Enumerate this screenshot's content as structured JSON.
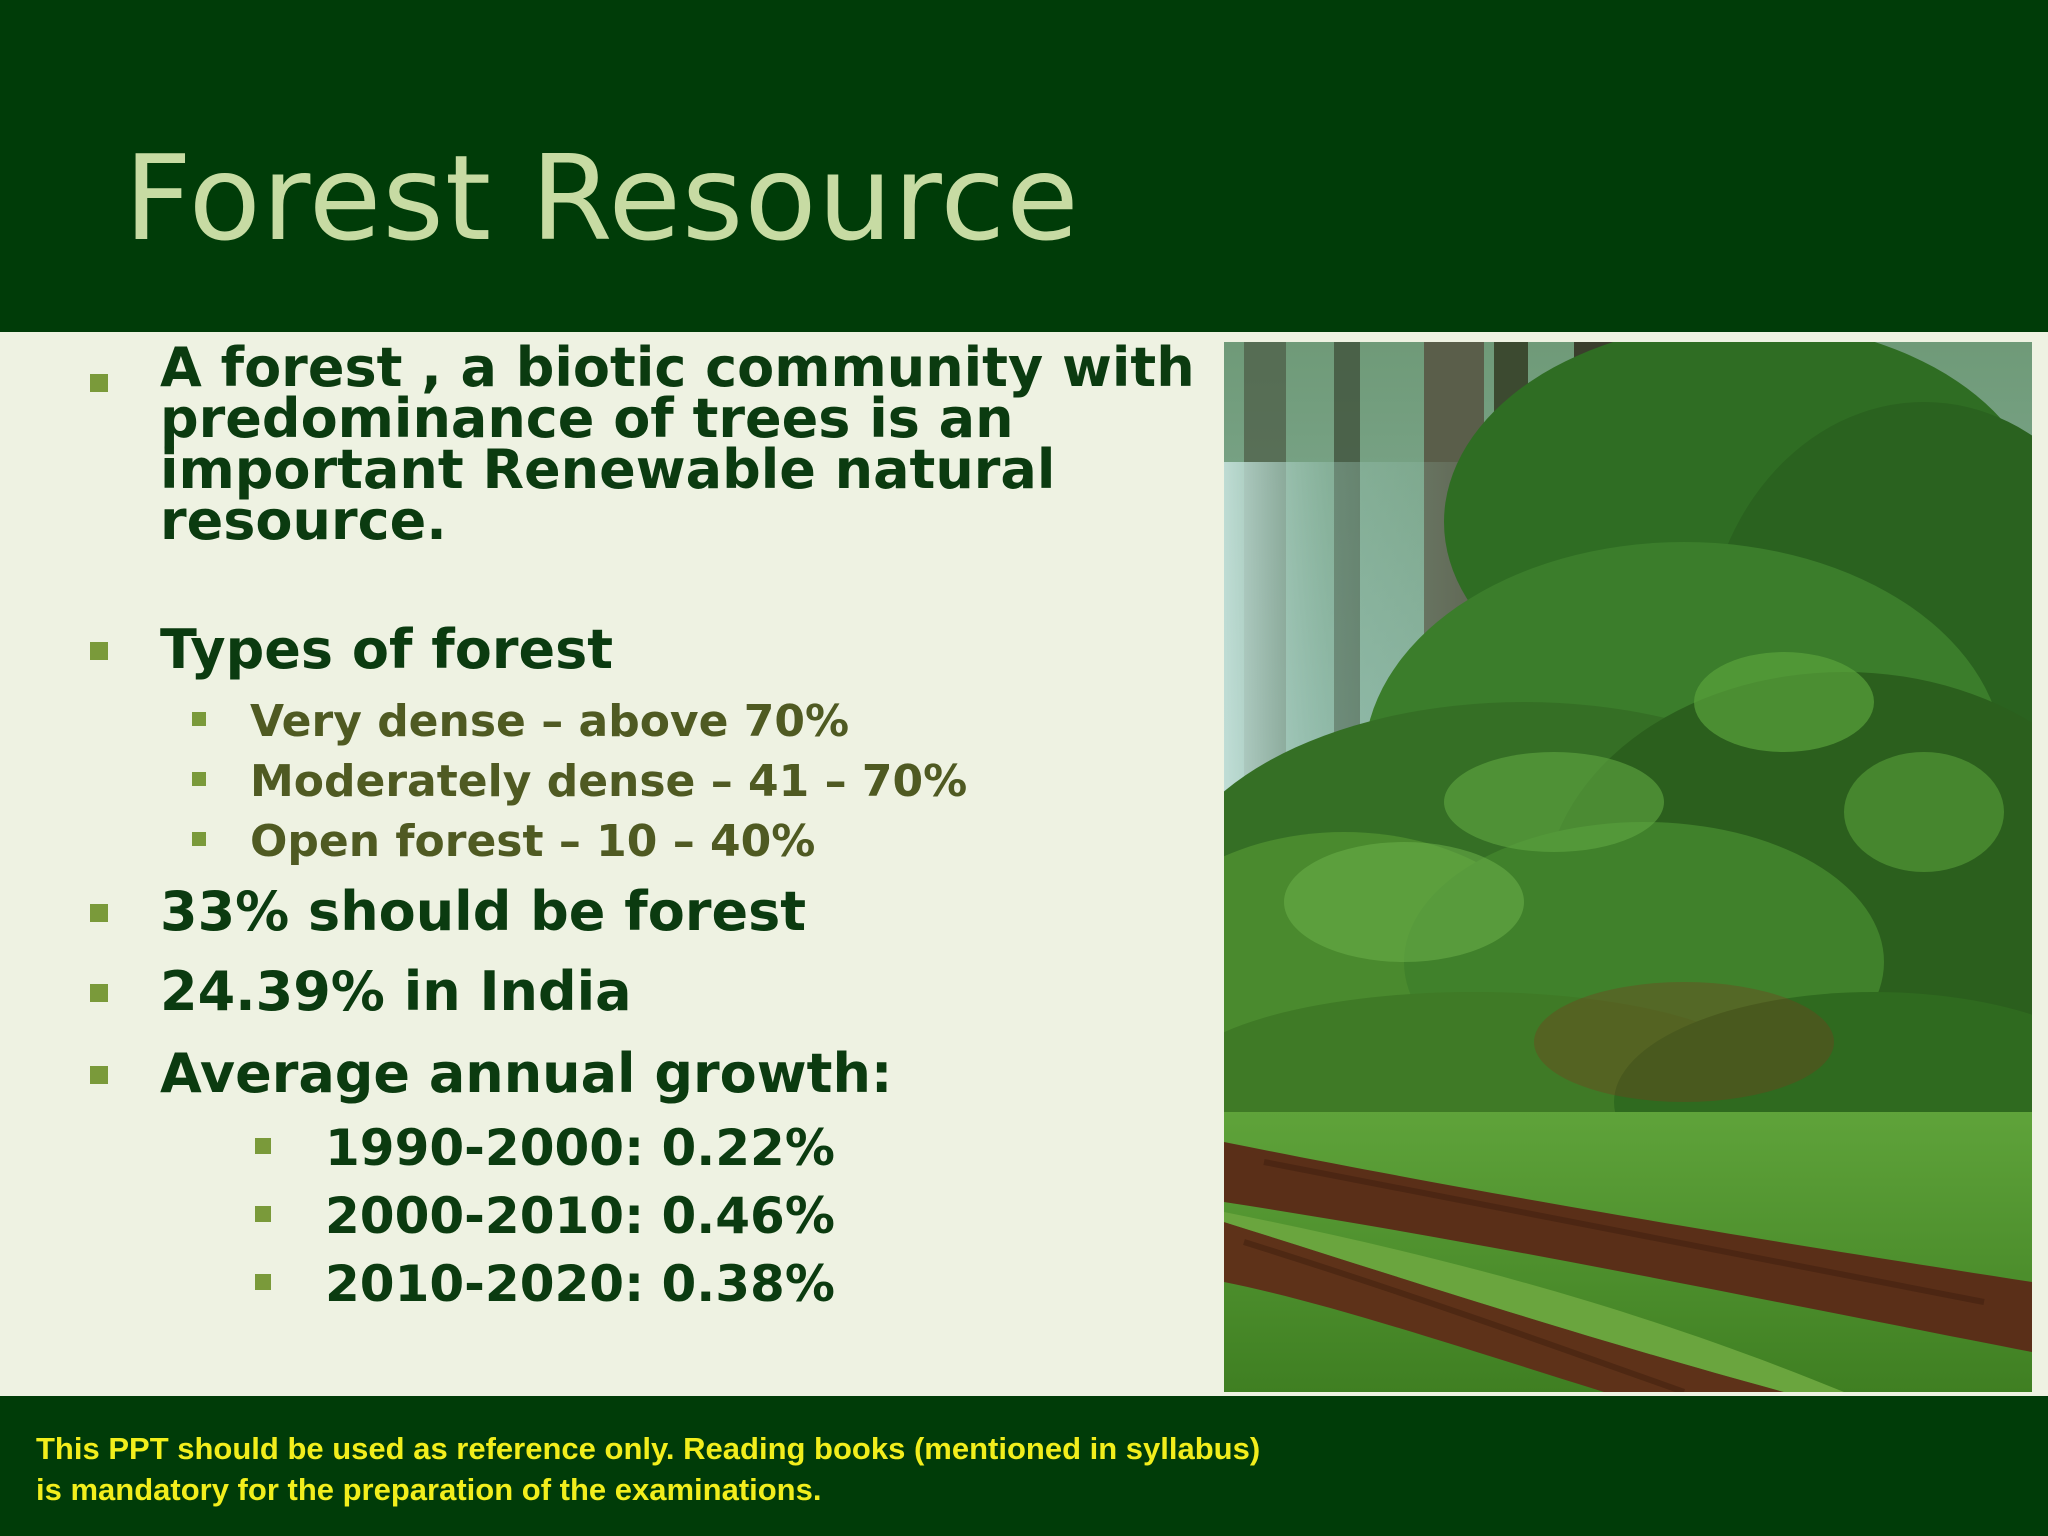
{
  "slide": {
    "title": "Forest Resource"
  },
  "bullets": [
    {
      "lines": [
        "A forest , a biotic community with",
        "predominance of trees is an",
        "important Renewable natural",
        "resource."
      ]
    },
    {
      "text": "Types of forest",
      "sub": [
        "Very dense – above 70%",
        "Moderately dense – 41 – 70%",
        "Open forest – 10 – 40%"
      ]
    },
    {
      "text": "33% should be forest"
    },
    {
      "text": "24.39% in India"
    },
    {
      "text": "Average annual growth:",
      "sub": [
        "1990-2000: 0.22%",
        "2000-2010: 0.46%",
        "2010-2020: 0.38%"
      ]
    }
  ],
  "footer": {
    "disclaimer": "This PPT should be used as reference only. Reading books (mentioned in syllabus) is mandatory for the preparation of the examinations."
  },
  "colors": {
    "header_bg": "#003c08",
    "title": "#c7dba3",
    "body_bg": "#eef2e2",
    "bullet_text": "#0b3b10",
    "sub_bullet_text": "#4f5a22",
    "bullet_marker": "#7a9a3a",
    "disclaimer": "#f2ee1c"
  },
  "image": {
    "subject": "forest-path-photo"
  }
}
